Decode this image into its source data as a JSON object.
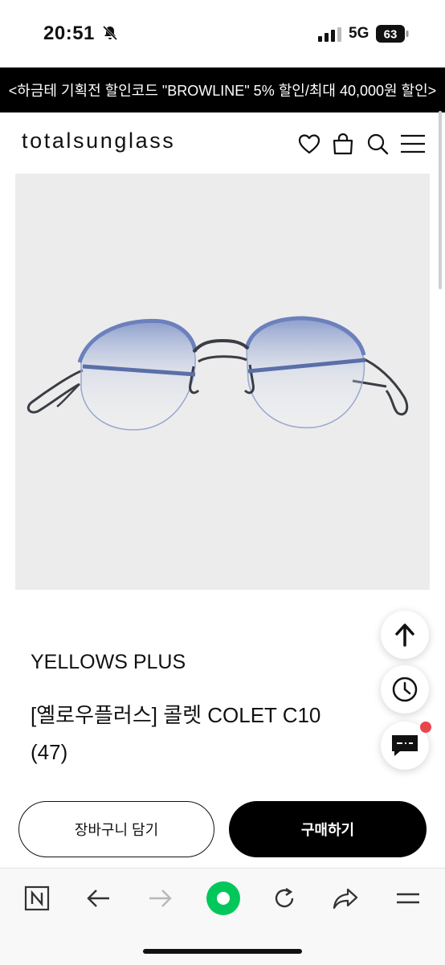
{
  "status_bar": {
    "time": "20:51",
    "network": "5G",
    "battery": "63"
  },
  "promo": {
    "text": "<하금테 기획전 할인코드 \"BROWLINE\" 5% 할인/최대 40,000원 할인>"
  },
  "header": {
    "logo": "totalsunglass",
    "icons": [
      "heart-icon",
      "bag-icon",
      "search-icon",
      "menu-icon"
    ]
  },
  "product": {
    "brand": "YELLOWS PLUS",
    "title_line1": "[옐로우플러스] 콜렛 COLET C10",
    "title_line2": "(47)"
  },
  "floating": {
    "icons": [
      "arrow-up-icon",
      "clock-icon",
      "chat-icon"
    ]
  },
  "actions": {
    "cart_label": "장바구니 담기",
    "buy_label": "구매하기"
  },
  "browser_bar": {
    "icons": [
      "naver-icon",
      "back-icon",
      "forward-icon",
      "home-icon",
      "reload-icon",
      "share-icon",
      "menu-icon"
    ]
  },
  "colors": {
    "accent_green": "#03c75a",
    "badge_red": "#e8454c",
    "black": "#000000"
  }
}
